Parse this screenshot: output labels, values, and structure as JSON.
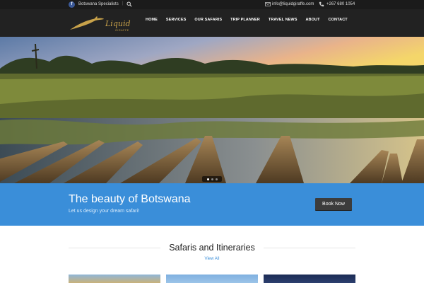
{
  "topbar": {
    "facebook_icon": "facebook-icon",
    "tagline": "Botswana Specialists",
    "separator": "|",
    "search_icon": "search-icon",
    "email": "info@liquidgiraffe.com",
    "phone": "+267 680 1054"
  },
  "header": {
    "logo_text": "Liquid",
    "logo_subtext": "GIRAFFE",
    "nav": [
      {
        "label": "HOME"
      },
      {
        "label": "SERVICES"
      },
      {
        "label": "OUR SAFARIS"
      },
      {
        "label": "TRIP PLANNER"
      },
      {
        "label": "TRAVEL NEWS"
      },
      {
        "label": "ABOUT"
      },
      {
        "label": "CONTACT"
      }
    ]
  },
  "hero": {
    "slider_dots": 3,
    "active_slide": 1
  },
  "banner": {
    "title": "The beauty of Botswana",
    "subtitle": "Let us design your dream safari!",
    "button": "Book Now",
    "color": "#3a8ed9"
  },
  "section": {
    "title": "Safaris and Itineraries",
    "view_all": "View All"
  }
}
